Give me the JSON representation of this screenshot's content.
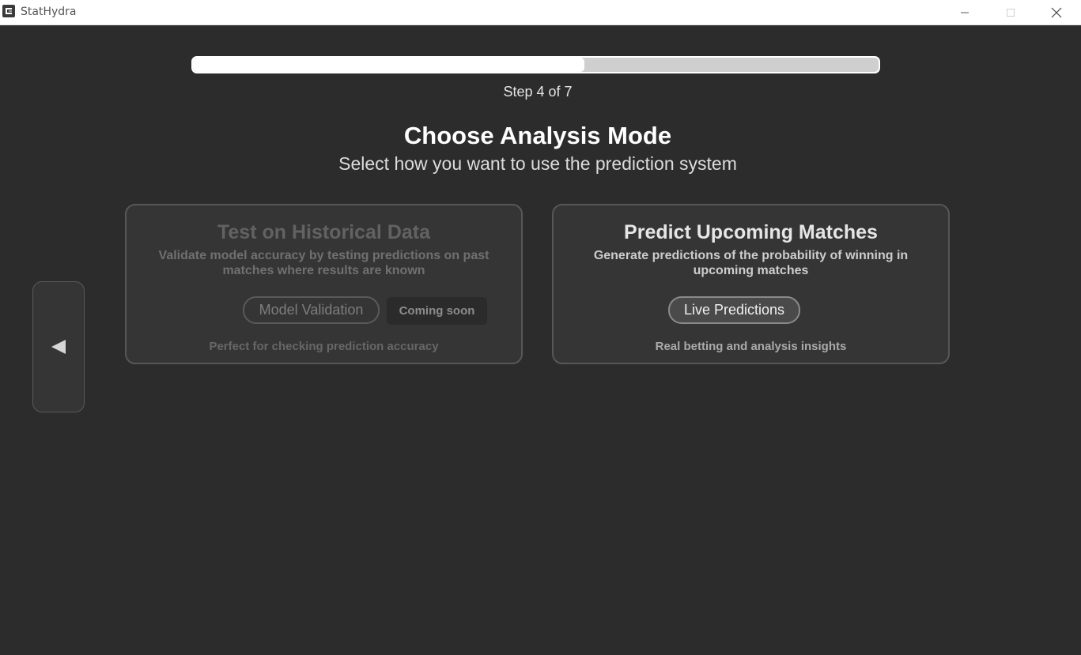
{
  "window": {
    "title": "StatHydra",
    "icons": [
      "app-logo-icon",
      "minimize-icon",
      "maximize-icon",
      "close-icon"
    ]
  },
  "progress": {
    "current_step": 4,
    "total_steps": 7,
    "fill_fraction": 0.571,
    "label": "Step 4 of 7"
  },
  "header": {
    "title": "Choose Analysis Mode",
    "subtitle": "Select how you want to use the prediction system"
  },
  "nav": {
    "back_icon": "triangle-left-icon"
  },
  "cards": {
    "historical": {
      "title": "Test on Historical Data",
      "description": "Validate model accuracy by testing predictions on past matches where results are known",
      "button_label": "Model Validation",
      "badge": "Coming soon",
      "note": "Perfect for checking prediction accuracy",
      "state": "disabled"
    },
    "upcoming": {
      "title": "Predict Upcoming Matches",
      "description": "Generate predictions of the probability of winning in upcoming matches",
      "button_label": "Live Predictions",
      "note": "Real betting and analysis insights",
      "state": "enabled"
    }
  },
  "colors": {
    "background": "#2c2c2c",
    "card_background": "#353535",
    "card_border": "#575757",
    "progress_fill": "#ffffff",
    "progress_track": "#cfcfcf"
  }
}
